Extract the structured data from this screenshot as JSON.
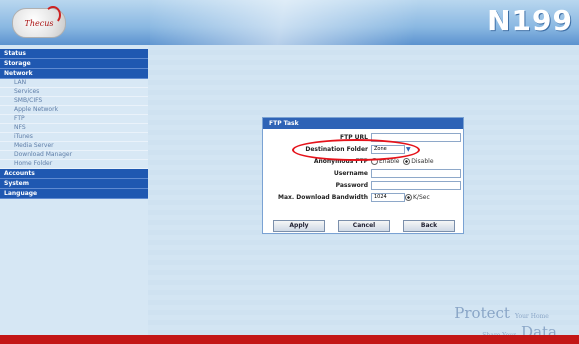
{
  "header": {
    "logo_text": "Thecus",
    "model": "N199"
  },
  "sidebar": {
    "sections": [
      {
        "label": "Status"
      },
      {
        "label": "Storage"
      },
      {
        "label": "Network",
        "items": [
          "LAN",
          "Services",
          "SMB/CIFS",
          "Apple Network",
          "FTP",
          "NFS",
          "iTunes",
          "Media Server",
          "Download Manager",
          "Home Folder"
        ]
      },
      {
        "label": "Accounts"
      },
      {
        "label": "System"
      },
      {
        "label": "Language"
      }
    ]
  },
  "dialog": {
    "title": "FTP Task",
    "fields": {
      "ftp_url_label": "FTP URL",
      "destination_label": "Destination Folder",
      "destination_value": "Zone",
      "anonymous_label": "Anonymous FTP",
      "anonymous_enable": "Enable",
      "anonymous_disable": "Disable",
      "anonymous_selected": "Disable",
      "username_label": "Username",
      "password_label": "Password",
      "bandwidth_label": "Max. Download Bandwidth",
      "bandwidth_value": "1024",
      "bandwidth_unit": "K/Sec"
    },
    "buttons": {
      "apply": "Apply",
      "cancel": "Cancel",
      "back": "Back"
    }
  },
  "footer": {
    "tagline_top": "Protect",
    "tagline_small1": "Your Home",
    "tagline_small2": "Share Your",
    "tagline_bottom": "Data"
  },
  "colors": {
    "nav_section": "#1f58b1",
    "dialog_header": "#2e63b6",
    "highlight": "#e5121a",
    "footer_bar": "#c31616"
  }
}
